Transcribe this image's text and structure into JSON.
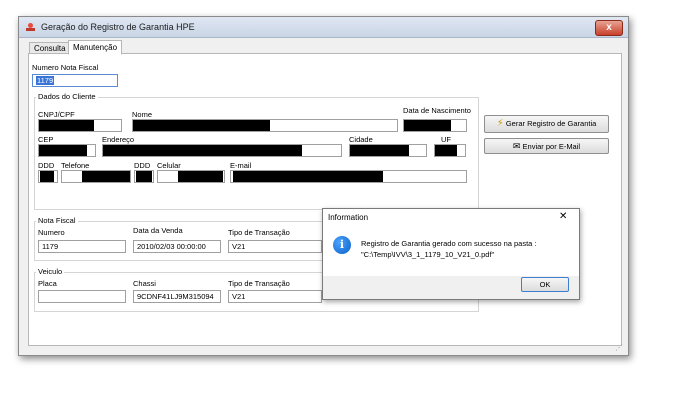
{
  "window": {
    "title": "Geração do Registro de Garantia HPE",
    "close_glyph": "x"
  },
  "tabs": [
    {
      "label": "Consulta",
      "active": false
    },
    {
      "label": "Manutenção",
      "active": true
    }
  ],
  "nota_top": {
    "label": "Numero Nota Fiscal",
    "value": "1179"
  },
  "cliente": {
    "group_title": "Dados do Cliente",
    "cnpj_label": "CNPJ/CPF",
    "nome_label": "Nome",
    "nascimento_label": "Data de Nascimento",
    "cep_label": "CEP",
    "endereco_label": "Endereço",
    "cidade_label": "Cidade",
    "uf_label": "UF",
    "ddd_label": "DDD",
    "telefone_label": "Telefone",
    "ddd2_label": "DDD",
    "celular_label": "Celular",
    "email_label": "E-mail"
  },
  "nota_fiscal": {
    "group_title": "Nota Fiscal",
    "numero_label": "Numero",
    "numero_value": "1179",
    "data_label": "Data da Venda",
    "data_value": "2010/02/03 00:00:00",
    "tipo_label": "Tipo de Transação",
    "tipo_value": "V21"
  },
  "veiculo": {
    "group_title": "Veiculo",
    "placa_label": "Placa",
    "placa_value": "",
    "chassi_label": "Chassi",
    "chassi_value": "9CDNF41LJ9M315094",
    "tipo_label": "Tipo de Transação",
    "tipo_value": "V21"
  },
  "buttons": {
    "gerar": "Gerar Registro de Garantia",
    "email": "Enviar por E-Mail"
  },
  "dialog": {
    "title": "Information",
    "close_glyph": "✕",
    "message_line1": "Registro de Garantia gerado com sucesso na pasta :",
    "message_line2": "\"C:\\Temp\\IVV\\3_1_1179_10_V21_0.pdf\"",
    "ok_label": "OK",
    "icon_glyph": "i"
  },
  "colors": {
    "accent": "#3875d7",
    "info_icon": "#0b5fc6",
    "close_button": "#c8412b"
  }
}
